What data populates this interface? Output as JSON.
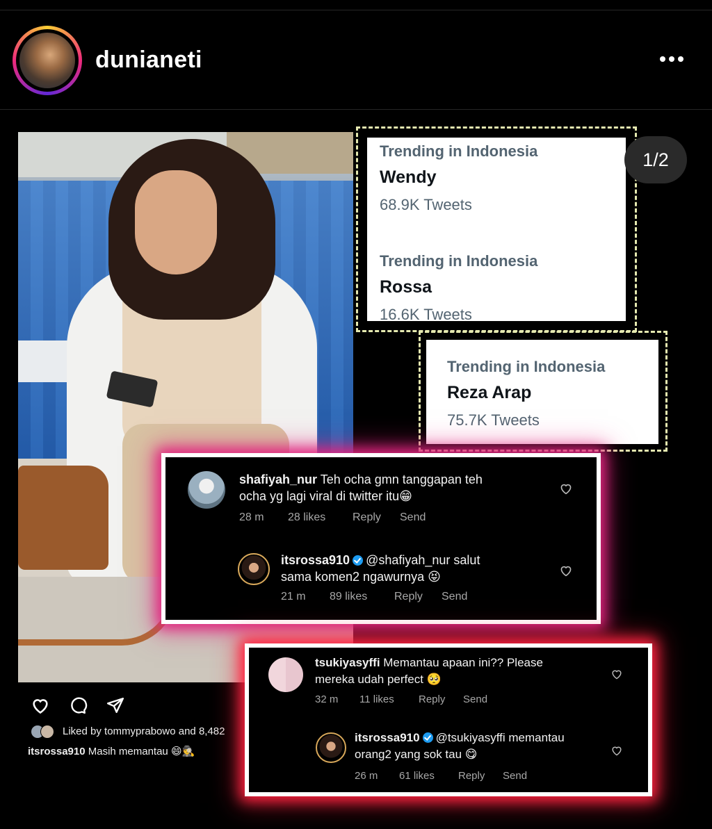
{
  "header": {
    "username": "dunianeti"
  },
  "post": {
    "pager": "1/2",
    "liked_text": "Liked by tommyprabowo and 8,482",
    "caption_user": "itsrossa910",
    "caption_text": " Masih memantau 😄🕵"
  },
  "trends": [
    {
      "label": "Trending in Indonesia",
      "name": "Wendy",
      "count": "68.9K Tweets"
    },
    {
      "label": "Trending in Indonesia",
      "name": "Rossa",
      "count": "16.6K Tweets"
    },
    {
      "label": "Trending in Indonesia",
      "name": "Reza Arap",
      "count": "75.7K Tweets"
    }
  ],
  "comments_1": [
    {
      "user": "shafiyah_nur",
      "line1": " Teh ocha gmn tanggapan teh",
      "line2": "ocha yg lagi viral di twitter itu😁",
      "time": "28 m",
      "likes": "28 likes",
      "reply": "Reply",
      "send": "Send"
    },
    {
      "user": "itsrossa910",
      "line1": "@shafiyah_nur  salut",
      "line2": "sama komen2 ngawurnya 😝",
      "time": "21 m",
      "likes": "89 likes",
      "reply": "Reply",
      "send": "Send"
    }
  ],
  "comments_2": [
    {
      "user": "tsukiyasyffi",
      "line1": " Memantau apaan ini?? Please",
      "line2": "mereka udah perfect 🥺",
      "time": "32 m",
      "likes": "11 likes",
      "reply": "Reply",
      "send": "Send"
    },
    {
      "user": "itsrossa910",
      "line1": "@tsukiyasyffi memantau",
      "line2": "orang2 yang sok tau 😋",
      "time": "26 m",
      "likes": "61 likes",
      "reply": "Reply",
      "send": "Send"
    }
  ],
  "icons": [
    "more-horizontal-icon",
    "heart-icon",
    "comment-icon",
    "share-icon",
    "verified-badge-icon"
  ],
  "colors": {
    "background": "#000000",
    "trend_border": "#e5e9b0",
    "glow_pink": "#e0257f",
    "glow_red": "#ff2340",
    "verified": "#1d9bf0"
  }
}
